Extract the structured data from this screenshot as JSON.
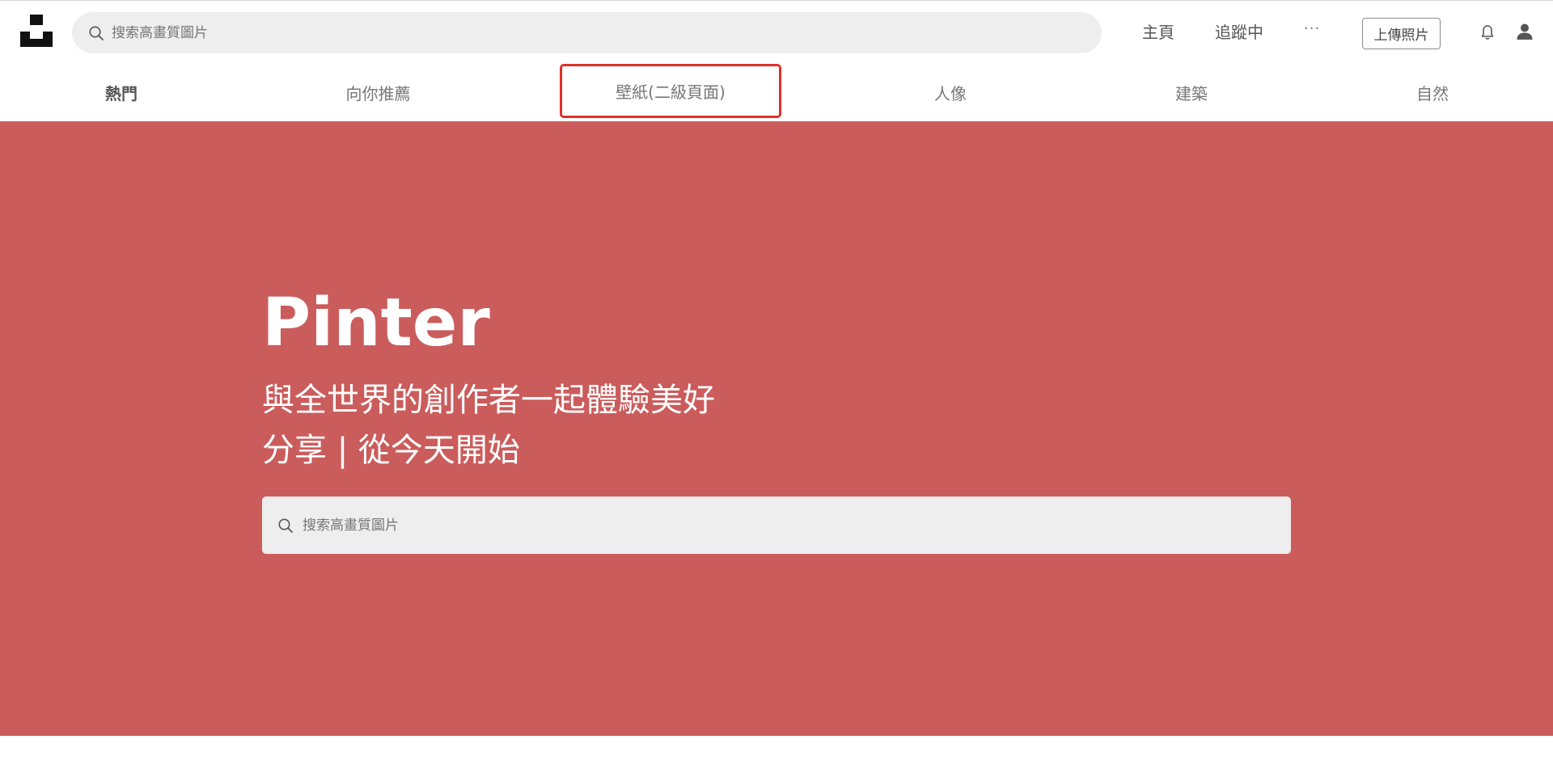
{
  "header": {
    "search_placeholder": "搜索高畫質圖片",
    "nav": {
      "home": "主頁",
      "following": "追蹤中",
      "more": "···"
    },
    "upload_label": "上傳照片"
  },
  "tabs": [
    {
      "label": "熱門",
      "active": true
    },
    {
      "label": "向你推薦",
      "active": false
    },
    {
      "label": "壁紙(二級頁面)",
      "active": false,
      "highlighted": true
    },
    {
      "label": "人像",
      "active": false
    },
    {
      "label": "建築",
      "active": false
    },
    {
      "label": "自然",
      "active": false
    }
  ],
  "hero": {
    "title": "Pinter",
    "subtitle_line1": "與全世界的創作者一起體驗美好",
    "subtitle_line2": "分享 | 從今天開始",
    "search_placeholder": "搜索高畫質圖片",
    "background_color": "#cb5c5c"
  },
  "colors": {
    "highlight_border": "#e0302a",
    "search_bg": "#eeeeee"
  },
  "icons": {
    "logo": "unsplash-logo",
    "search": "search-icon",
    "bell": "bell-icon",
    "user": "user-icon"
  }
}
